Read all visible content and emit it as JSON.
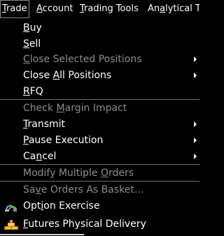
{
  "menubar": {
    "items": [
      {
        "pre": "",
        "key": "T",
        "post": "rade"
      },
      {
        "pre": "",
        "key": "A",
        "post": "ccount"
      },
      {
        "pre": "",
        "key": "T",
        "post": "rading Tools"
      },
      {
        "pre": "An",
        "key": "a",
        "post": "lytical To"
      }
    ]
  },
  "menu": {
    "items": [
      {
        "pre": "",
        "key": "B",
        "post": "uy"
      },
      {
        "pre": "",
        "key": "S",
        "post": "ell"
      },
      {
        "pre": "",
        "key": "C",
        "post": "lose Selected Positions"
      },
      {
        "pre": "Close ",
        "key": "A",
        "post": "ll Positions"
      },
      {
        "pre": "",
        "key": "R",
        "post": "FQ"
      },
      {
        "pre": "Check ",
        "key": "M",
        "post": "argin Impact"
      },
      {
        "pre": "",
        "key": "T",
        "post": "ransmit"
      },
      {
        "pre": "",
        "key": "P",
        "post": "ause Execution"
      },
      {
        "pre": "Ca",
        "key": "n",
        "post": "cel"
      },
      {
        "pre": "Modify Multiple ",
        "key": "O",
        "post": "rders"
      },
      {
        "pre": "Sa",
        "key": "v",
        "post": "e Orders As Basket..."
      },
      {
        "pre": "Opt",
        "key": "i",
        "post": "on Exercise"
      },
      {
        "pre": "",
        "key": "F",
        "post": "utures Physical Delivery"
      }
    ]
  },
  "icons": {
    "option_exercise": "option-exercise-icon",
    "futures_delivery": "futures-delivery-icon",
    "submenu": "chevron-right-icon"
  },
  "colors": {
    "background": "#000000",
    "text": "#ffffff",
    "disabled_text": "#8c8c8c",
    "separator": "#6e6e6e"
  }
}
